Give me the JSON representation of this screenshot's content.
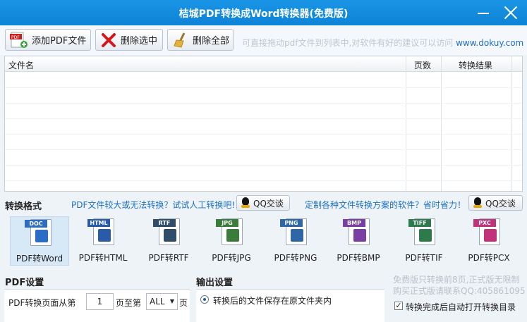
{
  "window": {
    "title": "桔城PDF转换成Word转换器(免费版)"
  },
  "toolbar": {
    "add_label": "添加PDF文件",
    "delete_selected_label": "删除选中",
    "delete_all_label": "删除全部",
    "tip_text": "可直接拖动pdf文件到列表中,对软件有好的建议可以访问 ",
    "tip_link": "www.dokuy.com"
  },
  "file_list": {
    "columns": [
      "文件名",
      "页数",
      "转换结果"
    ],
    "rows": []
  },
  "convert": {
    "section_title": "转换格式",
    "manual_link": "PDF文件较大或无法转换？试试人工转换吧!",
    "qq_label": "QQ交谈",
    "custom_link": "定制各种文件转换方案的软件？省时省力！",
    "qq2_label": "QQ交谈"
  },
  "formats": [
    {
      "label": "PDF转Word",
      "tag": "DOC",
      "color": "#2b6cc4",
      "selected": true
    },
    {
      "label": "PDF转HTML",
      "tag": "HTML",
      "color": "#2a5ba8",
      "selected": false
    },
    {
      "label": "PDF转RTF",
      "tag": "RTF",
      "color": "#2f4d6b",
      "selected": false
    },
    {
      "label": "PDF转JPG",
      "tag": "JPG",
      "color": "#3a7d3a",
      "selected": false
    },
    {
      "label": "PDF转PNG",
      "tag": "PNG",
      "color": "#2f66a6",
      "selected": false
    },
    {
      "label": "PDF转BMP",
      "tag": "BMP",
      "color": "#7a3fa3",
      "selected": false
    },
    {
      "label": "PDF转TIF",
      "tag": "TIFF",
      "color": "#2d7a4a",
      "selected": false
    },
    {
      "label": "PDF转PCX",
      "tag": "PXC",
      "color": "#c0337a",
      "selected": false
    }
  ],
  "pdf_settings": {
    "title": "PDF设置",
    "range_prefix": "PDF转换页面从第",
    "start_page": "1",
    "range_mid": "页至第",
    "end_page": "ALL",
    "range_suffix": "页"
  },
  "output_settings": {
    "title": "输出设置",
    "same_folder_label": "转换后的文件保存在原文件夹内"
  },
  "notice": {
    "line1": "免费版只转换前8页,正式版无限制",
    "line2": "购买正式版请联系QQ:405861095",
    "open_dir_label": "转换完成后自动打开转换目录"
  }
}
